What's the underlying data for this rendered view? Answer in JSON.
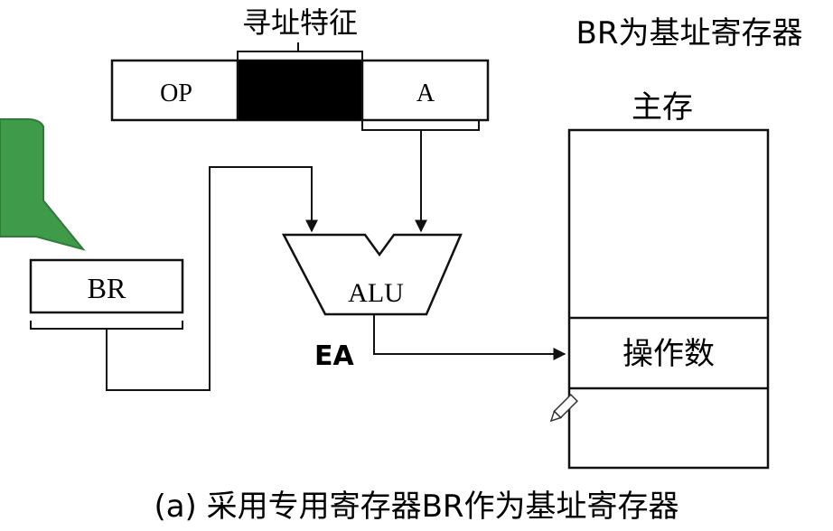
{
  "labels": {
    "addressing_feature": "寻址特征",
    "base_register_note": "BR为基址寄存器",
    "main_memory": "主存",
    "op_field": "OP",
    "a_field": "A",
    "br_register": "BR",
    "alu": "ALU",
    "ea": "EA",
    "operand": "操作数",
    "caption": "(a) 采用专用寄存器BR作为基址寄存器"
  },
  "colors": {
    "line": "#111111",
    "addressing_field_fill": "#000000",
    "callout_fill": "#3f9b49",
    "callout_border": "#2f7c38"
  },
  "icons": {
    "cursor": "pen-cursor-icon"
  }
}
